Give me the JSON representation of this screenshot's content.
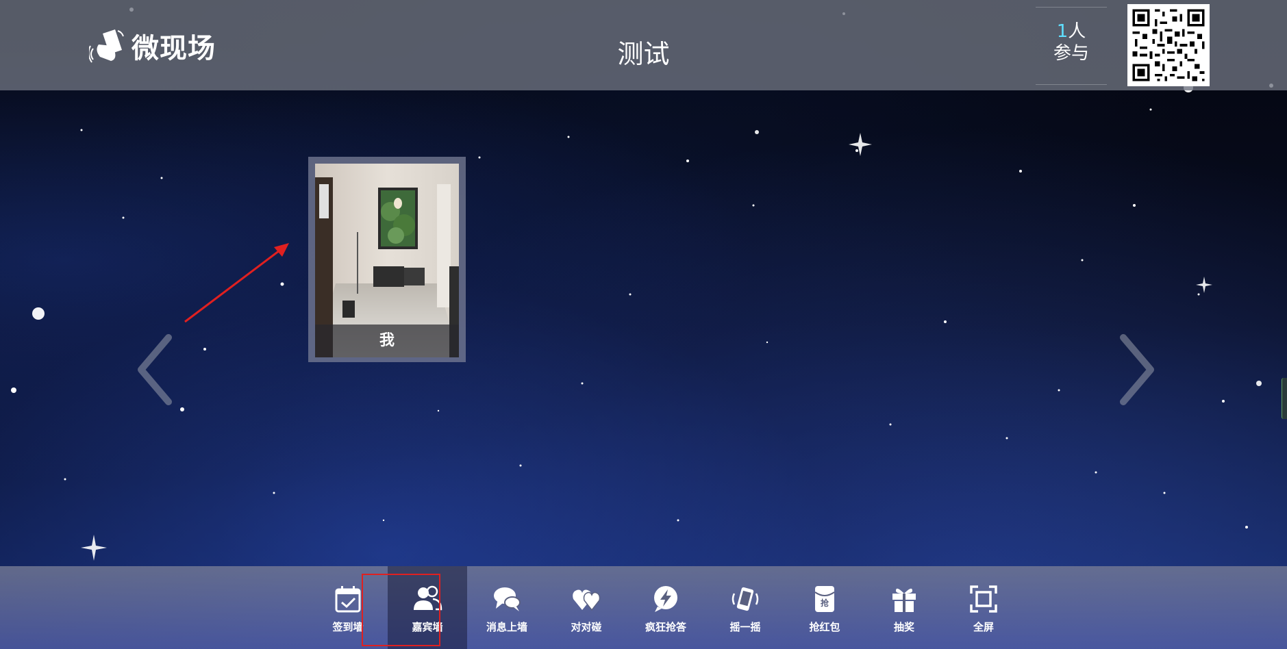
{
  "header": {
    "logo_text": "微现场",
    "title": "测试",
    "participants": {
      "count": "1",
      "unit": "人",
      "label": "参与"
    }
  },
  "guest_wall": {
    "guests": [
      {
        "name": "我"
      }
    ]
  },
  "toolbar": {
    "items": [
      {
        "label": "签到墙",
        "icon": "calendar-check-icon",
        "active": false
      },
      {
        "label": "嘉宾墙",
        "icon": "users-icon",
        "active": true
      },
      {
        "label": "消息上墙",
        "icon": "chat-bubbles-icon",
        "active": false
      },
      {
        "label": "对对碰",
        "icon": "hearts-icon",
        "active": false
      },
      {
        "label": "疯狂抢答",
        "icon": "lightning-bubble-icon",
        "active": false
      },
      {
        "label": "摇一摇",
        "icon": "shake-phone-icon",
        "active": false
      },
      {
        "label": "抢红包",
        "icon": "red-envelope-icon",
        "active": false,
        "icon_text": "抢"
      },
      {
        "label": "抽奖",
        "icon": "gift-icon",
        "active": false
      },
      {
        "label": "全屏",
        "icon": "fullscreen-icon",
        "active": false
      }
    ]
  },
  "colors": {
    "header_bg": "#6e7380",
    "participant_count": "#5fe0ff",
    "annotation": "#e02020",
    "text": "#ffffff"
  }
}
